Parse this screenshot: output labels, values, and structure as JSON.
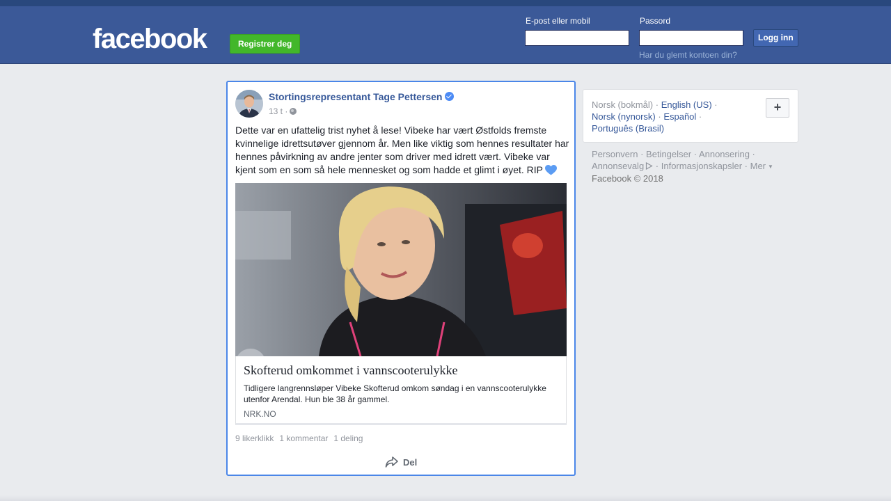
{
  "header": {
    "logo": "facebook",
    "register_label": "Registrer deg",
    "email_label": "E-post eller mobil",
    "email_value": "",
    "password_label": "Passord",
    "password_value": "",
    "login_label": "Logg inn",
    "forgot_label": "Har du glemt kontoen din?"
  },
  "post": {
    "author": "Stortingsrepresentant Tage Pettersen",
    "time": "13 t ·",
    "text": "Dette var en ufattelig trist nyhet å lese! Vibeke har vært Østfolds fremste kvinnelige idrettsutøver gjennom år. Men like viktig som hennes resultater har hennes påvirkning av andre jenter som driver med idrett vært. Vibeke var kjent som en som så hele mennesket og som hadde et glimt i øyet. RIP",
    "link": {
      "title": "Skofterud omkommet i vannscooterulykke",
      "description": "Tidligere langrennsløper Vibeke Skofterud omkom søndag i en vannscooterulykke utenfor Arendal. Hun ble 38 år gammel.",
      "domain": "NRK.NO"
    },
    "likes": "9 likerklikk",
    "comments": "1 kommentar",
    "shares": "1 deling",
    "share_label": "Del"
  },
  "sidebar": {
    "languages": {
      "current": "Norsk (bokmål)",
      "options": [
        "English (US)",
        "Norsk (nynorsk)",
        "Español",
        "Português (Brasil)"
      ]
    },
    "plus_label": "+",
    "footer": {
      "links": [
        "Personvern",
        "Betingelser",
        "Annonsering",
        "Annonsevalg",
        "Informasjonskapsler",
        "Mer"
      ],
      "copyright": "Facebook © 2018"
    }
  },
  "colors": {
    "header_bg": "#3b5998",
    "register_green": "#42b72a",
    "link_blue": "#365899",
    "focus_border": "#4a86e8"
  }
}
